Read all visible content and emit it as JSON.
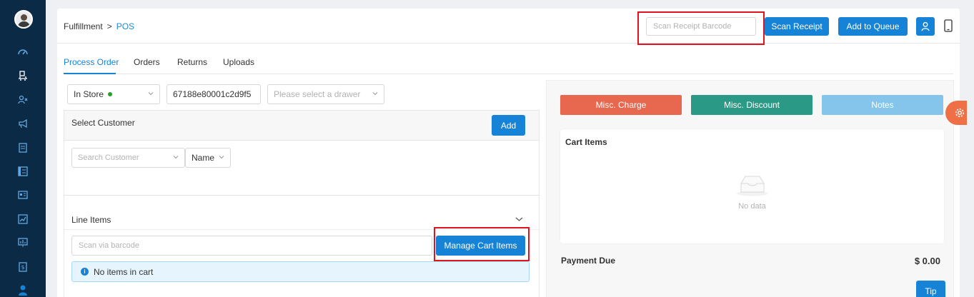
{
  "breadcrumb": {
    "parent": "Fulfillment",
    "separator": ">",
    "current": "POS"
  },
  "header": {
    "scan_receipt_placeholder": "Scan Receipt Barcode",
    "scan_receipt_label": "Scan Receipt",
    "add_to_queue_label": "Add to Queue"
  },
  "tabs": [
    {
      "label": "Process Order",
      "active": true
    },
    {
      "label": "Orders",
      "active": false
    },
    {
      "label": "Returns",
      "active": false
    },
    {
      "label": "Uploads",
      "active": false
    }
  ],
  "order_options": {
    "channel": "In Store",
    "channel_status_color": "#2a9d2a",
    "order_id": "67188e80001c2d9f5",
    "drawer_placeholder": "Please select a drawer"
  },
  "customer": {
    "section_label": "Select Customer",
    "add_label": "Add",
    "search_placeholder": "Search Customer",
    "search_by": "Name"
  },
  "line_items": {
    "section_label": "Line Items",
    "barcode_placeholder": "Scan via barcode",
    "manage_label": "Manage Cart Items",
    "empty_message": "No items in cart"
  },
  "right_panel": {
    "misc_charge_label": "Misc. Charge",
    "misc_discount_label": "Misc. Discount",
    "notes_label": "Notes",
    "cart_items_title": "Cart Items",
    "empty_text": "No data",
    "payment_due_label": "Payment Due",
    "payment_due_amount": "$ 0.00",
    "tip_label": "Tip"
  },
  "colors": {
    "primary": "#1783d7",
    "sidebar": "#0b2a45",
    "misc_charge": "#e8674f",
    "misc_discount": "#2a9a86",
    "notes": "#85c5ec",
    "highlight": "#e0131f",
    "settings_fab": "#ef6f46"
  },
  "sidebar_icons": [
    "dashboard-icon",
    "delivery-icon",
    "users-icon",
    "megaphone-icon",
    "document-icon",
    "list-icon",
    "id-card-icon",
    "chart-icon",
    "monitor-chart-icon",
    "receipt-icon",
    "person-icon"
  ]
}
